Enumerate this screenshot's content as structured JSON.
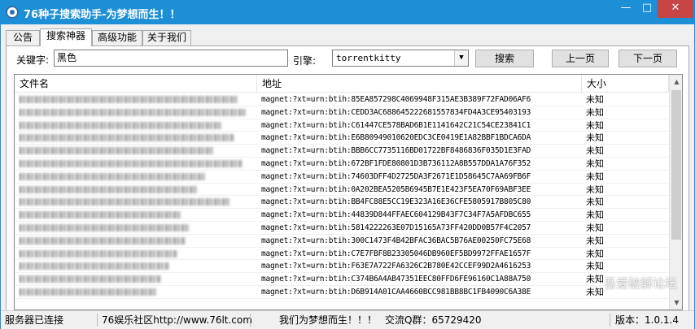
{
  "window": {
    "title": "76种子搜索助手-为梦想而生！！",
    "minimize_glyph": "—",
    "maximize_glyph": "□",
    "close_glyph": "✕",
    "accent": "#1c8fd6"
  },
  "tabs": [
    {
      "label": "公告"
    },
    {
      "label": "搜索神器"
    },
    {
      "label": "高级功能"
    },
    {
      "label": "关于我们"
    }
  ],
  "search": {
    "keyword_label": "关键字:",
    "keyword_value": "黑色",
    "engine_label": "引擎:",
    "engine_value": "torrentkitty",
    "search_button": "搜索",
    "prev_button": "上一页",
    "next_button": "下一页"
  },
  "table": {
    "columns": [
      "文件名",
      "地址",
      "大小"
    ],
    "rows": [
      {
        "link": "magnet:?xt=urn:btih:85EA857298C4069948F315AE3B389F72FAD06AF6",
        "size": "未知"
      },
      {
        "link": "magnet:?xt=urn:btih:CEDD3AC688645222681557834FD4A3CE95403193",
        "size": "未知"
      },
      {
        "link": "magnet:?xt=urn:btih:C61447CE578BAD6B1E1141642C21C54CE23841C1",
        "size": "未知"
      },
      {
        "link": "magnet:?xt=urn:btih:E6B80949010620EDC3CE0419E1A82BBF1BDCA6DA",
        "size": "未知"
      },
      {
        "link": "magnet:?xt=urn:btih:BBB6CC7735116BD01722BF8486836F035D1E3FAD",
        "size": "未知"
      },
      {
        "link": "magnet:?xt=urn:btih:672BF1FDE80801D3B736112A8B557DDA1A76F352",
        "size": "未知"
      },
      {
        "link": "magnet:?xt=urn:btih:74603DFF4D2725DA3F2671E1D58645C7AA69FB6F",
        "size": "未知"
      },
      {
        "link": "magnet:?xt=urn:btih:0A202BEA5205B6945B7E1E423F5EA70F69ABF3EE",
        "size": "未知"
      },
      {
        "link": "magnet:?xt=urn:btih:BB4FC88E5CC19E323A16E36CFE5805917B805C80",
        "size": "未知"
      },
      {
        "link": "magnet:?xt=urn:btih:44839D844FFAEC604129B43F7C34F7A5AFDBC655",
        "size": "未知"
      },
      {
        "link": "magnet:?xt=urn:btih:5814222263E07D15165A73FF420DD0B57F4C2057",
        "size": "未知"
      },
      {
        "link": "magnet:?xt=urn:btih:300C1473F4B42BFAC36BAC5B76AE00250FC75E68",
        "size": "未知"
      },
      {
        "link": "magnet:?xt=urn:btih:C7E7FBF8B23305046DB960EF5BD9972FFAE1657F",
        "size": "未知"
      },
      {
        "link": "magnet:?xt=urn:btih:F63E7A722FA6326C2B780E42CCEF99D2A4616253",
        "size": "未知"
      },
      {
        "link": "magnet:?xt=urn:btih:C374B6A4AB47351EEC80FFD6FE96160C1A88A750",
        "size": "未知"
      },
      {
        "link": "magnet:?xt=urn:btih:D6B914A01CAA4660BCC981BB8BC1FB4090C6A38E",
        "size": "未知"
      }
    ]
  },
  "status": {
    "connection": "服务器已连接",
    "community": "76娱乐社区http://www.76lt.com",
    "slogan": "我们为梦想而生！！！",
    "qq_group": "交流Q群：65729420",
    "version": "版本：1.0.1.4"
  },
  "watermark": "吾爱破解论坛"
}
